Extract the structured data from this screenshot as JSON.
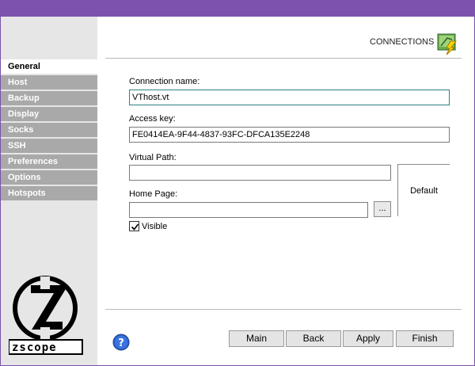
{
  "header": {
    "title": "CONNECTIONS",
    "icon": "connection-plug-icon"
  },
  "sidebar": {
    "items": [
      {
        "label": "General",
        "active": true
      },
      {
        "label": "Host",
        "active": false
      },
      {
        "label": "Backup",
        "active": false
      },
      {
        "label": "Display",
        "active": false
      },
      {
        "label": "Socks",
        "active": false
      },
      {
        "label": "SSH",
        "active": false
      },
      {
        "label": "Preferences",
        "active": false
      },
      {
        "label": "Options",
        "active": false
      },
      {
        "label": "Hotspots",
        "active": false
      }
    ],
    "logo_text": "zscope"
  },
  "form": {
    "connection_name_label": "Connection name:",
    "connection_name_value": "VThost.vt",
    "access_key_label": "Access key:",
    "access_key_value": "FE0414EA-9F44-4837-93FC-DFCA135E2248",
    "virtual_path_label": "Virtual Path:",
    "virtual_path_value": "",
    "home_page_label": "Home Page:",
    "home_page_value": "",
    "browse_label": "...",
    "default_label": "Default",
    "visible_label": "Visible",
    "visible_checked": true
  },
  "footer": {
    "help_icon": "help-icon",
    "buttons": {
      "main": "Main",
      "back": "Back",
      "apply": "Apply",
      "finish": "Finish"
    }
  },
  "colors": {
    "titlebar": "#7b52ae",
    "sidebar_bg": "#e6e6e6",
    "nav_inactive": "#a9a9a9",
    "focus_border": "#2f7f86"
  }
}
